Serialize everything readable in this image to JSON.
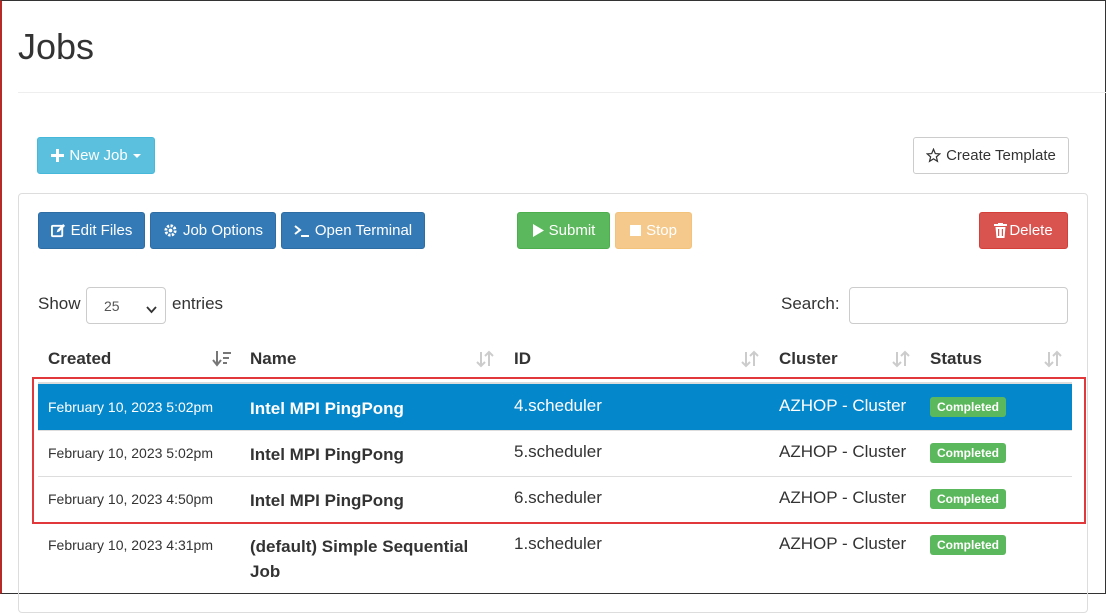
{
  "page": {
    "title": "Jobs"
  },
  "toolbar_top": {
    "new_job_label": "New Job",
    "create_template_label": "Create Template"
  },
  "toolbar_actions": {
    "edit_files_label": "Edit Files",
    "job_options_label": "Job Options",
    "open_terminal_label": "Open Terminal",
    "submit_label": "Submit",
    "stop_label": "Stop",
    "delete_label": "Delete"
  },
  "table_controls": {
    "show_label": "Show",
    "entries_value": "25",
    "entries_label": "entries",
    "search_label": "Search:",
    "search_value": ""
  },
  "table": {
    "columns": [
      "Created",
      "Name",
      "ID",
      "Cluster",
      "Status"
    ],
    "rows": [
      {
        "created": "February 10, 2023 5:02pm",
        "name": "Intel MPI PingPong",
        "id": "4.scheduler",
        "cluster": "AZHOP - Cluster",
        "status": "Completed",
        "selected": true
      },
      {
        "created": "February 10, 2023 5:02pm",
        "name": "Intel MPI PingPong",
        "id": "5.scheduler",
        "cluster": "AZHOP - Cluster",
        "status": "Completed",
        "selected": false
      },
      {
        "created": "February 10, 2023 4:50pm",
        "name": "Intel MPI PingPong",
        "id": "6.scheduler",
        "cluster": "AZHOP - Cluster",
        "status": "Completed",
        "selected": false
      },
      {
        "created": "February 10, 2023 4:31pm",
        "name": "(default) Simple Sequential Job",
        "id": "1.scheduler",
        "cluster": "AZHOP - Cluster",
        "status": "Completed",
        "selected": false
      }
    ]
  },
  "colors": {
    "selected_row": "#0587cc",
    "status_completed": "#5cb85c",
    "highlight_box": "#e0383b"
  }
}
